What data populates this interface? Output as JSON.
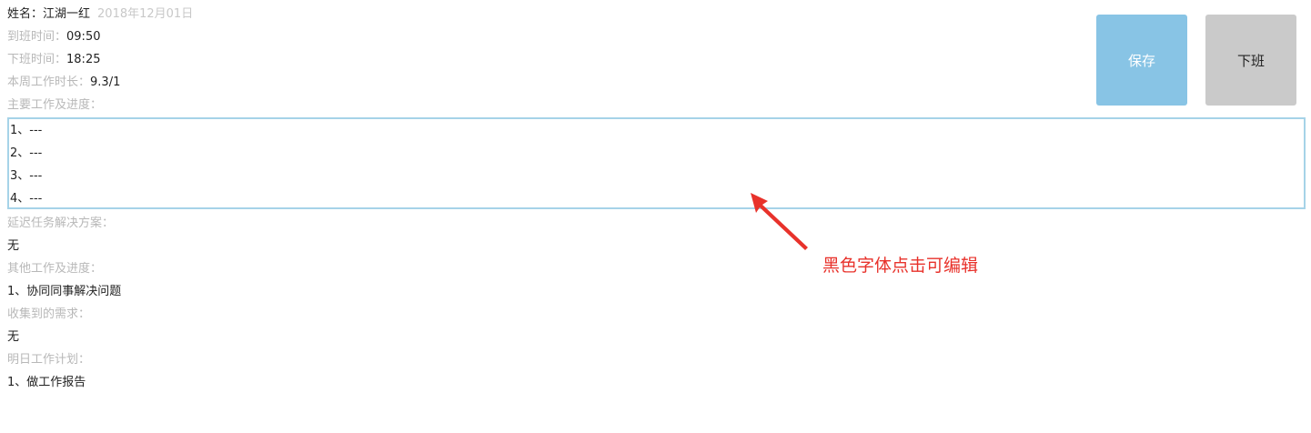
{
  "header": {
    "name_label": "姓名：",
    "name_value": "江湖一红",
    "date": "2018年12月01日"
  },
  "times": {
    "arrive_label": "到班时间：",
    "arrive_value": "09:50",
    "leave_label": "下班时间：",
    "leave_value": "18:25",
    "week_label": "本周工作时长：",
    "week_value": "9.3/1"
  },
  "main_work": {
    "label": "主要工作及进度：",
    "lines": [
      "1、---",
      "2、---",
      "3、---",
      "4、---"
    ]
  },
  "delay": {
    "label": "延迟任务解决方案：",
    "value": "无"
  },
  "other_work": {
    "label": "其他工作及进度：",
    "value": "1、协同同事解决问题"
  },
  "requirements": {
    "label": "收集到的需求：",
    "value": "无"
  },
  "tomorrow_plan": {
    "label": "明日工作计划：",
    "value": "1、做工作报告"
  },
  "buttons": {
    "save_label": "保存",
    "off_duty_label": "下班"
  },
  "annotation": {
    "text": "黑色字体点击可编辑"
  },
  "colors": {
    "save_button": "#88c4e5",
    "off_duty_button": "#cacaca",
    "edit_box_border": "#a6d3e8",
    "annotation": "#e8322b",
    "label_text": "#b8b8b8"
  }
}
